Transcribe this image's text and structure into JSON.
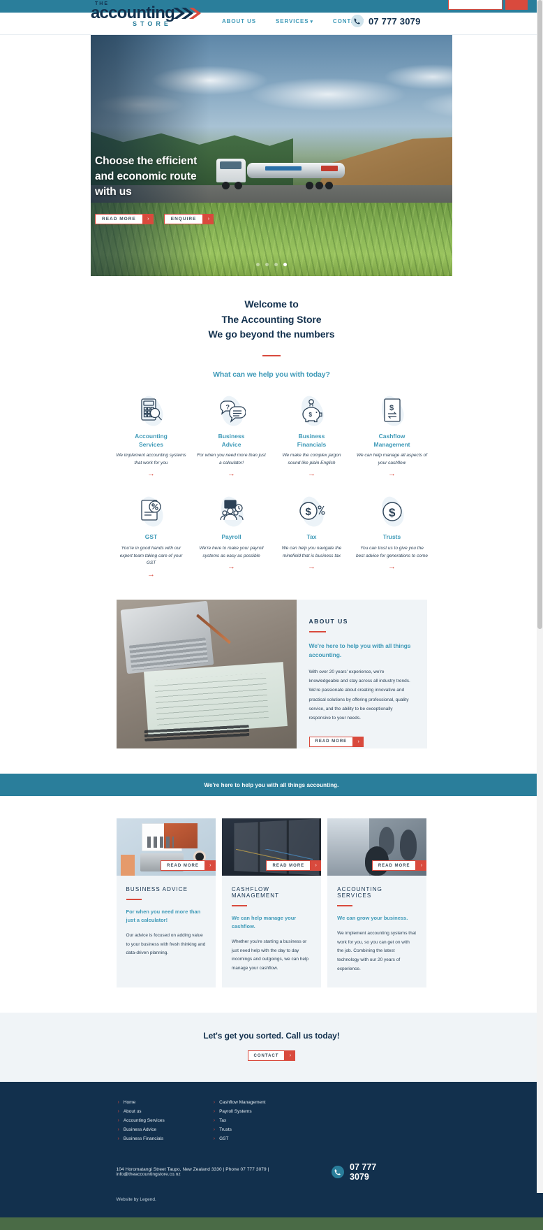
{
  "topbar": {
    "search_placeholder": "",
    "search_value": "",
    "search_button_label": ""
  },
  "header": {
    "logo": {
      "the": "THE",
      "main": "accounting",
      "sub": "STORE",
      "chevrons_icon": "double-chevron-icon"
    },
    "nav": [
      {
        "label": "ABOUT US",
        "has_dropdown": false
      },
      {
        "label": "SERVICES",
        "has_dropdown": true,
        "caret": "▾"
      },
      {
        "label": "CONTACT",
        "has_dropdown": false
      }
    ],
    "phone": "07 777 3079",
    "phone_icon": "phone-icon"
  },
  "hero": {
    "title": "Choose the efficient and economic route with us",
    "title_line1": "Choose the efficient",
    "title_line2": "and economic route",
    "title_line3": "with us",
    "buttons": [
      {
        "label": "READ MORE",
        "arrow": "›"
      },
      {
        "label": "ENQUIRE",
        "arrow": "›"
      }
    ],
    "slider_dots": 4,
    "active_dot": 4
  },
  "welcome": {
    "line1": "Welcome to",
    "line2": "The Accounting Store",
    "line3": "We go beyond the numbers",
    "subtitle": "What can we help you with today?"
  },
  "services": [
    {
      "name": "Accounting Services",
      "name_line1": "Accounting",
      "name_line2": "Services",
      "desc": "We implement accounting systems that work for you",
      "icon": "calculator-magnifier-icon",
      "arrow": "→"
    },
    {
      "name": "Business Advice",
      "name_line1": "Business",
      "name_line2": "Advice",
      "desc": "For when you need more than just a calculator!",
      "icon": "speech-bubbles-question-icon",
      "arrow": "→"
    },
    {
      "name": "Business Financials",
      "name_line1": "Business",
      "name_line2": "Financials",
      "desc": "We make the complex jargon sound like plain English",
      "icon": "piggy-bank-icon",
      "arrow": "→"
    },
    {
      "name": "Cashflow Management",
      "name_line1": "Cashflow",
      "name_line2": "Management",
      "desc": "We can help manage all aspects of your cashflow",
      "icon": "document-dollar-exchange-icon",
      "arrow": "→"
    },
    {
      "name": "GST",
      "name_line1": "GST",
      "name_line2": "",
      "desc": "You're in good hands with our expert team taking care of your GST",
      "icon": "document-percent-icon",
      "arrow": "→"
    },
    {
      "name": "Payroll",
      "name_line1": "Payroll",
      "name_line2": "",
      "desc": "We're here to make your payroll systems as easy as possible",
      "icon": "payroll-people-clock-icon",
      "arrow": "→"
    },
    {
      "name": "Tax",
      "name_line1": "Tax",
      "name_line2": "",
      "desc": "We can help you navigate the minefield that is business tax",
      "icon": "dollar-circle-percent-icon",
      "arrow": "→"
    },
    {
      "name": "Trusts",
      "name_line1": "Trusts",
      "name_line2": "",
      "desc": "You can trust us to give you the best advice for generations to come",
      "icon": "dollar-circle-icon",
      "arrow": "→"
    }
  ],
  "about": {
    "kicker": "ABOUT US",
    "lead": "We're here to help you with all things accounting.",
    "body": "With over 20 years' experience, we're knowledgeable and stay across all industry trends. We're passionate about creating innovative and practical solutions by offering professional, quality service, and the ability to be exceptionally responsive to your needs.",
    "button": {
      "label": "READ MORE",
      "arrow": "›"
    },
    "image_alt": "hand-writing-notes-laptop-photo"
  },
  "banner": {
    "text": "We're here to help you with all things accounting."
  },
  "cards": [
    {
      "title": "BUSINESS ADVICE",
      "lead": "For when you need more than just a calculator!",
      "desc": "Our advice is focused on adding value to your business with fresh thinking and data-driven planning.",
      "button": {
        "label": "READ MORE",
        "arrow": "›"
      },
      "image_alt": "desk-flatlay-laptop-chart-photo"
    },
    {
      "title": "CASHFLOW MANAGEMENT",
      "lead": "We can help manage your cashflow.",
      "desc": "Whether you're starting a business or just need help with the day to day incomings and outgoings, we can help manage your cashflow.",
      "button": {
        "label": "READ MORE",
        "arrow": "›"
      },
      "image_alt": "financial-dashboard-screen-photo"
    },
    {
      "title": "ACCOUNTING SERVICES",
      "lead": "We can grow your business.",
      "desc": "We implement accounting systems that work for you, so you can get on with the job. Combining the latest technology with our 20 years of experience.",
      "button": {
        "label": "READ MORE",
        "arrow": "›"
      },
      "image_alt": "office-team-meeting-photo"
    }
  ],
  "cta": {
    "heading": "Let's get you sorted. Call us today!",
    "button": {
      "label": "CONTACT",
      "arrow": "›"
    }
  },
  "footer": {
    "links_col1": [
      "Home",
      "About us",
      "Accounting Services",
      "Business Advice",
      "Business Financials"
    ],
    "links_col2": [
      "Cashflow Management",
      "Payroll Systems",
      "Tax",
      "Trusts",
      "GST"
    ],
    "address": "104 Horomatangi Street Taupo, New Zealand 3330 | Phone 07 777 3079 | info@theaccountingstore.co.nz",
    "phone": "07 777 3079",
    "phone_icon": "phone-icon",
    "credit": "Website by Legend."
  },
  "colors": {
    "teal": "#2a7e9b",
    "navy": "#12304d",
    "red": "#d94a3d",
    "light_blue": "#3f9ab8",
    "panel": "#f0f4f7"
  }
}
